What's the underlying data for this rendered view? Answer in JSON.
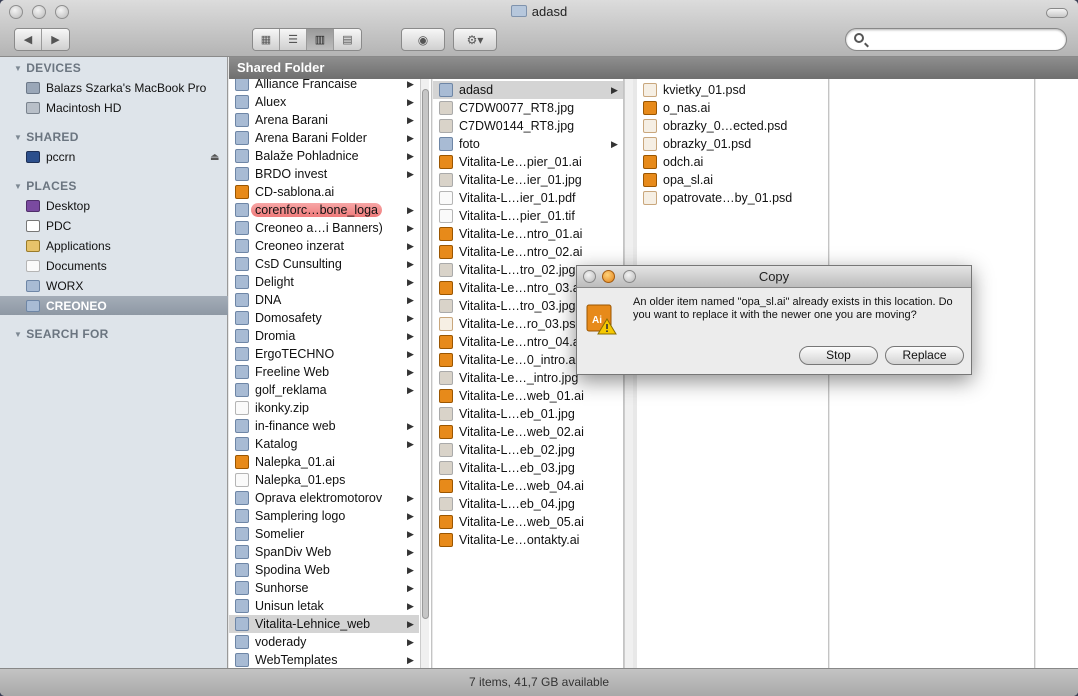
{
  "window": {
    "title": "adasd",
    "status": "7 items, 41,7 GB available"
  },
  "sidebar": {
    "devices_label": "DEVICES",
    "shared_label": "SHARED",
    "places_label": "PLACES",
    "search_label": "SEARCH FOR",
    "devices": [
      "Balazs Szarka's MacBook Pro",
      "Macintosh HD"
    ],
    "shared": [
      "pccrn"
    ],
    "places": [
      "Desktop",
      "PDC",
      "Applications",
      "Documents",
      "WORX",
      "CREONEO"
    ]
  },
  "path_label": "Shared Folder",
  "col1": [
    "Alliance Francaise",
    "Aluex",
    "Arena Barani",
    "Arena Barani Folder",
    "Balaže Pohladnice",
    "BRDO invest",
    "CD-sablona.ai",
    "corenforc…bone_loga",
    "Creoneo a…i Banners)",
    "Creoneo inzerat",
    "CsD Cunsulting",
    "Delight",
    "DNA",
    "Domosafety",
    "Dromia",
    "ErgoTECHNO",
    "Freeline Web",
    "golf_reklama",
    "ikonky.zip",
    "in-finance web",
    "Katalog",
    "Nalepka_01.ai",
    "Nalepka_01.eps",
    "Oprava elektromotorov",
    "Samplering logo",
    "Somelier",
    "SpanDiv Web",
    "Spodina Web",
    "Sunhorse",
    "Unisun letak",
    "Vitalita-Lehnice_web",
    "voderady",
    "WebTemplates"
  ],
  "col2": [
    "adasd",
    "C7DW0077_RT8.jpg",
    "C7DW0144_RT8.jpg",
    "foto",
    "Vitalita-Le…pier_01.ai",
    "Vitalita-Le…ier_01.jpg",
    "Vitalita-L…ier_01.pdf",
    "Vitalita-L…pier_01.tif",
    "Vitalita-Le…ntro_01.ai",
    "Vitalita-Le…ntro_02.ai",
    "Vitalita-L…tro_02.jpg",
    "Vitalita-Le…ntro_03.ai",
    "Vitalita-L…tro_03.jpg",
    "Vitalita-Le…ro_03.psd",
    "Vitalita-Le…ntro_04.ai",
    "Vitalita-Le…0_intro.ai",
    "Vitalita-Le…_intro.jpg",
    "Vitalita-Le…web_01.ai",
    "Vitalita-L…eb_01.jpg",
    "Vitalita-Le…web_02.ai",
    "Vitalita-L…eb_02.jpg",
    "Vitalita-L…eb_03.jpg",
    "Vitalita-Le…web_04.ai",
    "Vitalita-L…eb_04.jpg",
    "Vitalita-Le…web_05.ai",
    "Vitalita-Le…ontakty.ai"
  ],
  "col3": [
    "kvietky_01.psd",
    "o_nas.ai",
    "obrazky_0…ected.psd",
    "obrazky_01.psd",
    "odch.ai",
    "opa_sl.ai",
    "opatrovate…by_01.psd"
  ],
  "dialog": {
    "title": "Copy",
    "message": "An older item named \"opa_sl.ai\" already exists in this location. Do you want to replace it with the newer one you are moving?",
    "stop": "Stop",
    "replace": "Replace",
    "icon_text": "Ai"
  }
}
